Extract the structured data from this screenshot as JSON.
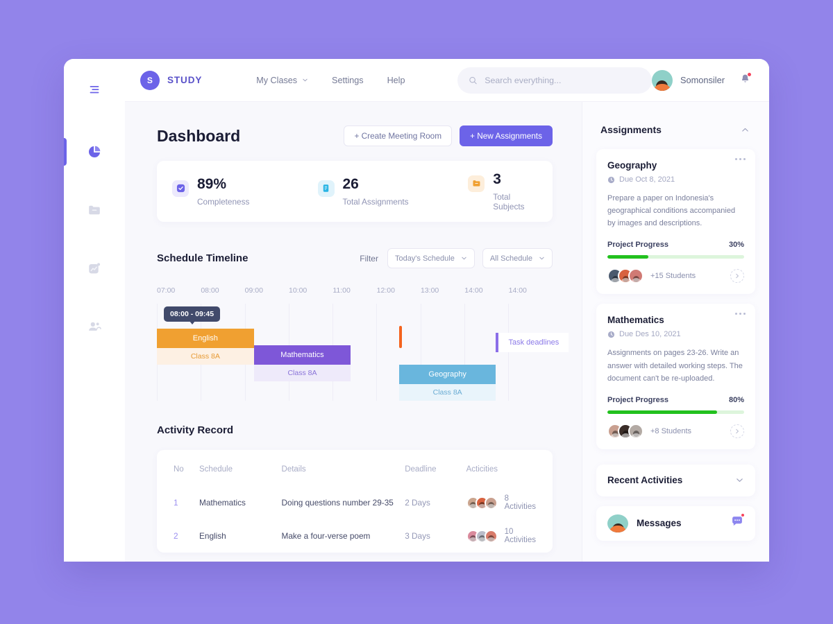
{
  "brand": {
    "badge": "S",
    "name": "STUDY"
  },
  "nav": [
    {
      "label": "My Clases",
      "icon": "chevron-down-icon",
      "has_chevron": true
    },
    {
      "label": "Settings",
      "has_chevron": false
    },
    {
      "label": "Help",
      "has_chevron": false
    }
  ],
  "search": {
    "placeholder": "Search everything...",
    "value": "",
    "icon": "search-icon"
  },
  "user": {
    "name": "Somonsiler",
    "avatar": "user-avatar",
    "notification_icon": "bell-icon",
    "has_notification": true
  },
  "sidebar": {
    "items": [
      {
        "name": "menu",
        "icon": "hamburger-menu-icon",
        "active": false
      },
      {
        "name": "dashboard",
        "icon": "pie-chart-icon",
        "active": true
      },
      {
        "name": "files",
        "icon": "folder-icon",
        "active": false
      },
      {
        "name": "analytics",
        "icon": "trending-chart-icon",
        "active": false
      },
      {
        "name": "students",
        "icon": "users-icon",
        "active": false
      }
    ]
  },
  "page": {
    "title": "Dashboard"
  },
  "actions": {
    "create_meeting": "+ Create Meeting Room",
    "new_assignments": "+ New Assignments"
  },
  "stats": [
    {
      "value": "89%",
      "label": "Completeness",
      "icon": "checkbox-icon",
      "color": "#6c63e8"
    },
    {
      "value": "26",
      "label": "Total Assignments",
      "icon": "document-icon",
      "color": "#28b4e4"
    },
    {
      "value": "3",
      "label": "Total Subjects",
      "icon": "folder-icon",
      "color": "#f0a031"
    }
  ],
  "schedule": {
    "title": "Schedule Timeline",
    "filter_label": "Filter",
    "filters": [
      {
        "value": "Today's Schedule",
        "icon": "chevron-down-icon"
      },
      {
        "value": "All Schedule",
        "icon": "chevron-down-icon"
      }
    ],
    "hours": [
      "07:00",
      "08:00",
      "09:00",
      "10:00",
      "11:00",
      "12:00",
      "13:00",
      "14:00",
      "14:00"
    ],
    "tooltip": "08:00 - 09:45",
    "blocks": [
      {
        "title": "English",
        "sub": "Class 8A",
        "color": "#f0a031",
        "sub_bg": "#fdf0e3",
        "sub_color": "#e79a34"
      },
      {
        "title": "Mathematics",
        "sub": "Class 8A",
        "color": "#7e57d8",
        "sub_bg": "#eeeafa",
        "sub_color": "#8a74d8"
      },
      {
        "title": "Geography",
        "sub": "Class 8A",
        "color": "#69b6dd",
        "sub_bg": "#e9f4fb",
        "sub_color": "#6aacd3"
      }
    ],
    "deadline_card": {
      "label": "Task deadlines",
      "color": "#8b6ee8"
    },
    "marker_color": "#f4631e"
  },
  "activity": {
    "title": "Activity Record",
    "columns": [
      "No",
      "Schedule",
      "Details",
      "Deadline",
      "Acticities"
    ],
    "rows": [
      {
        "no": "1",
        "schedule": "Mathematics",
        "details": "Doing questions number 29-35",
        "deadline": "2 Days",
        "activities": "8 Activities"
      },
      {
        "no": "2",
        "schedule": "English",
        "details": "Make a four-verse poem",
        "deadline": "3 Days",
        "activities": "10 Activities"
      }
    ]
  },
  "assignments": {
    "title": "Assignments",
    "collapse_icon": "chevron-up-icon",
    "cards": [
      {
        "title": "Geography",
        "due": "Due Oct 8, 2021",
        "description": "Prepare a paper on Indonesia's geographical conditions accompanied by images and descriptions.",
        "progress_label": "Project Progress",
        "progress_value": "30%",
        "progress_pct": 30,
        "students": "+15 Students"
      },
      {
        "title": "Mathematics",
        "due": "Due Des 10, 2021",
        "description": "Assignments on pages 23-26. Write an answer with detailed working steps. The document can't be re-uploaded.",
        "progress_label": "Project Progress",
        "progress_value": "80%",
        "progress_pct": 80,
        "students": "+8 Students"
      }
    ]
  },
  "recent_activities": {
    "title": "Recent Activities",
    "icon": "chevron-down-icon"
  },
  "messages": {
    "title": "Messages",
    "icon": "chat-bubble-icon",
    "has_notification": true
  },
  "colors": {
    "page_bg": "#9284ea",
    "primary": "#6c63e8",
    "progress": "#22c11e",
    "orange": "#f0a031",
    "purple_block": "#7e57d8",
    "blue_block": "#69b6dd"
  }
}
